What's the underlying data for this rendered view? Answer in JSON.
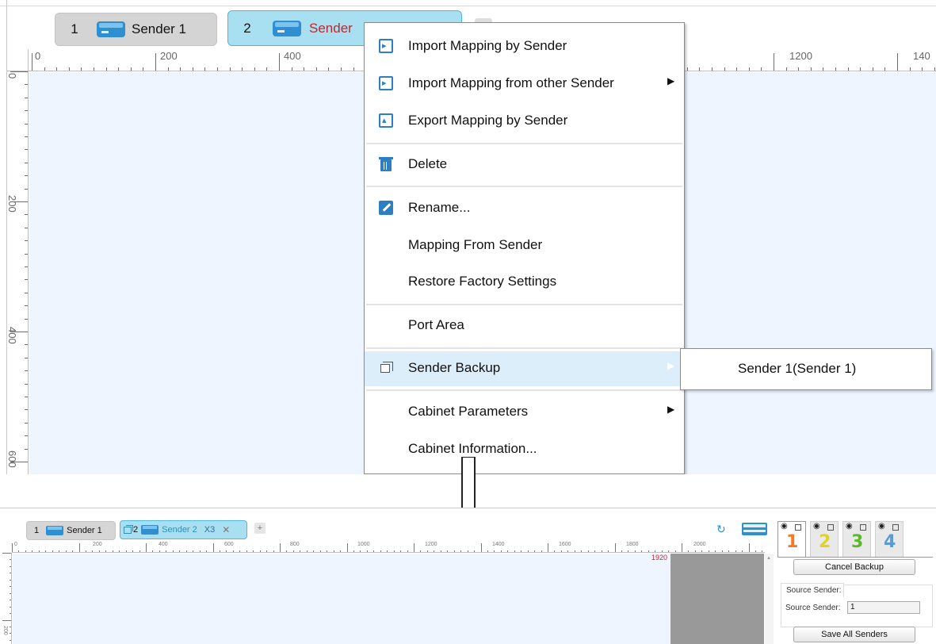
{
  "top": {
    "tabs": [
      {
        "num": "1",
        "label": "Sender 1"
      },
      {
        "num": "2",
        "label": "Sender"
      }
    ],
    "add_tab_label": "+",
    "ruler_h": [
      "0",
      "200",
      "400",
      "1200",
      "140"
    ],
    "ruler_v": [
      "0",
      "200",
      "400",
      "600"
    ]
  },
  "context_menu": {
    "items": [
      {
        "label": "Import Mapping by Sender",
        "icon": "import-icon"
      },
      {
        "label": "Import Mapping from other Sender",
        "icon": "import-icon",
        "submenu": true
      },
      {
        "label": "Export Mapping by Sender",
        "icon": "export-icon"
      },
      {
        "label": "Delete",
        "icon": "trash-icon"
      },
      {
        "label": "Rename...",
        "icon": "edit-icon"
      },
      {
        "label": "Mapping From Sender"
      },
      {
        "label": "Restore Factory Settings"
      },
      {
        "label": "Port Area"
      },
      {
        "label": "Sender Backup",
        "icon": "copy-icon",
        "submenu": true,
        "highlighted": true
      },
      {
        "label": "Cabinet Parameters",
        "submenu": true
      },
      {
        "label": "Cabinet Information..."
      }
    ],
    "submenu_item": "Sender 1(Sender 1)"
  },
  "bottom": {
    "tabs": [
      {
        "num": "1",
        "label": "Sender 1"
      },
      {
        "num": "2",
        "label": "Sender 2",
        "suffix": "X3",
        "close": "✕"
      }
    ],
    "add_tab_label": "+",
    "ruler_h": [
      "0",
      "200",
      "400",
      "600",
      "800",
      "1000",
      "1200",
      "1400",
      "1600",
      "1800",
      "2000"
    ],
    "ruler_v": [
      "200"
    ],
    "width_marker": "1920",
    "num_tabs": [
      "1",
      "2",
      "3",
      "4"
    ],
    "num_tab_colors": [
      "#f47b20",
      "#e3d21f",
      "#5cb82e",
      "#5b9bd5"
    ],
    "cancel_backup_label": "Cancel Backup",
    "source_group_title": "Source Sender:",
    "source_sender_label": "Source Sender:",
    "source_sender_value": "1",
    "save_all_label": "Save All Senders"
  }
}
